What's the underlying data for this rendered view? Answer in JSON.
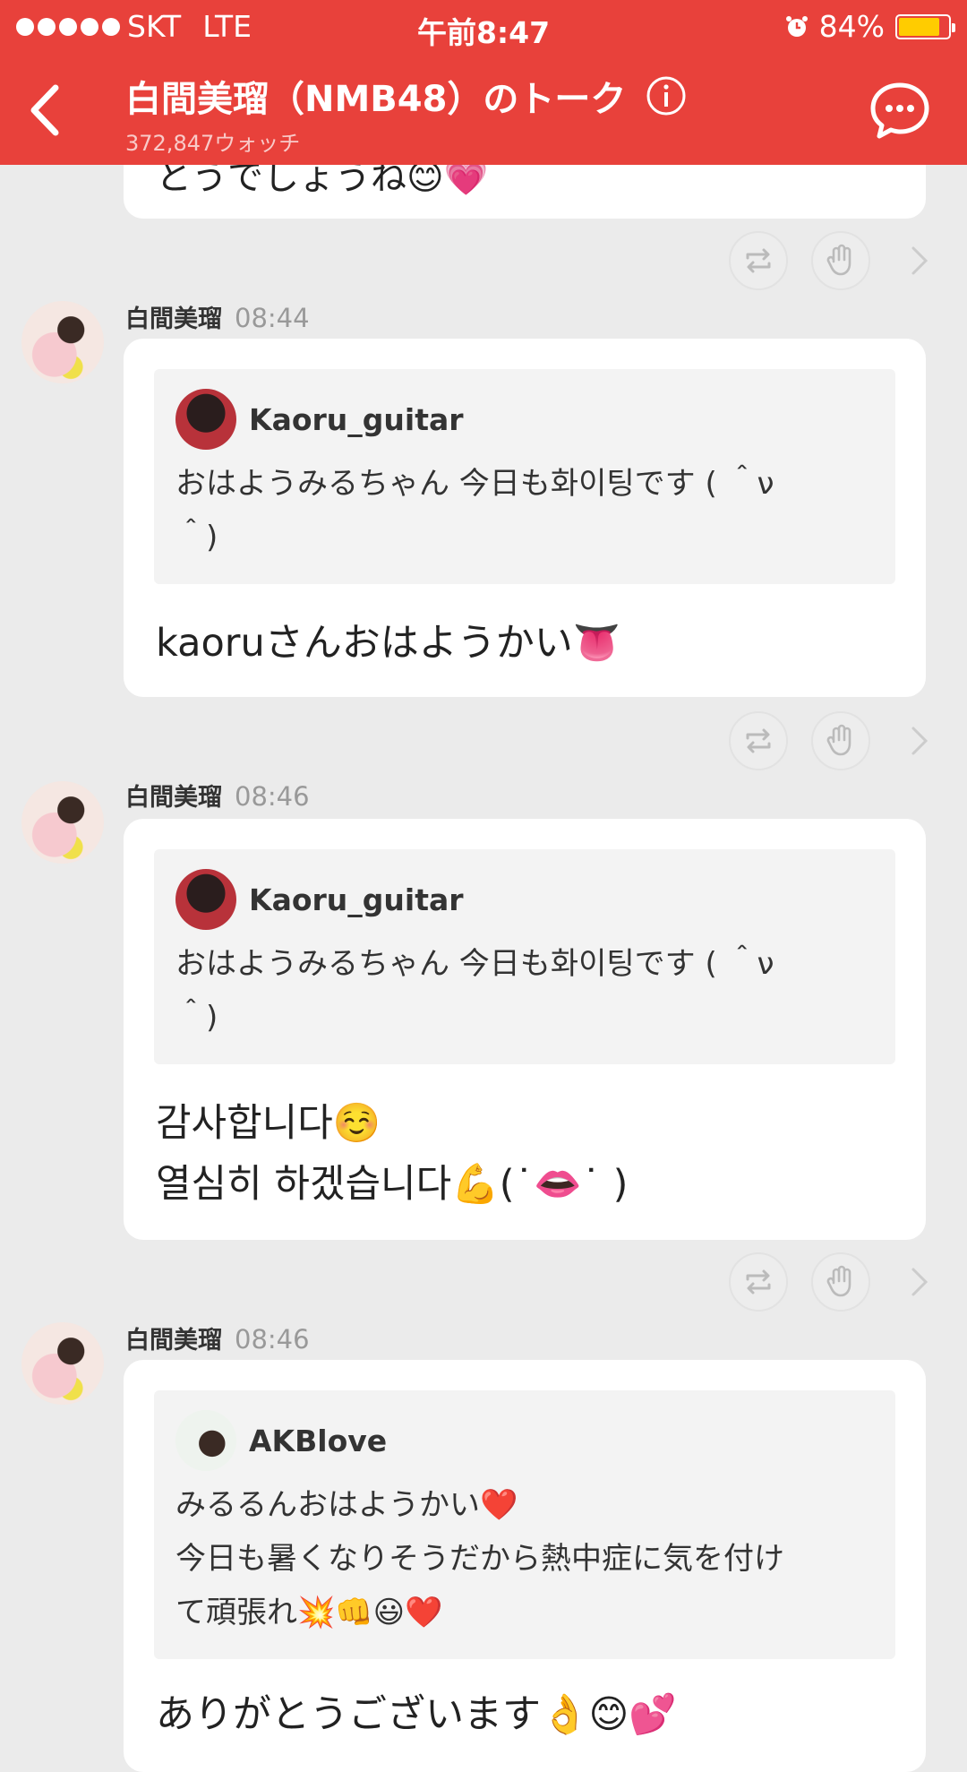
{
  "status_bar": {
    "carrier": "SKT",
    "network": "LTE",
    "time": "午前8:47",
    "battery": "84%",
    "battery_level": 0.84
  },
  "header": {
    "title": "白間美瑠（NMB48）のトーク",
    "watch_count": "372,847ウォッチ"
  },
  "partial_top_text": "とうでしょうね😊💗",
  "posts": [
    {
      "author": "白間美瑠",
      "time": "08:44",
      "quote": {
        "user": "Kaoru_guitar",
        "text": "おはようみるちゃん 今日も화이팅です ( ＾ν\n＾)"
      },
      "reply": "kaoruさんおはようかい👅"
    },
    {
      "author": "白間美瑠",
      "time": "08:46",
      "quote": {
        "user": "Kaoru_guitar",
        "text": "おはようみるちゃん 今日も화이팅です ( ＾ν\n＾)"
      },
      "reply": "감사합니다☺️\n열심히 하겠습니다💪(˙👄˙ )"
    },
    {
      "author": "白間美瑠",
      "time": "08:46",
      "quote": {
        "user": "AKBlove",
        "text": "みるるんおはようかい❤️\n今日も暑くなりそうだから熱中症に気を付け\nて頑張れ💥👊😃❤️"
      },
      "reply": "ありがとうございます👌😊💕"
    }
  ],
  "colors": {
    "header": "#e8413b",
    "background": "#ebebeb"
  }
}
